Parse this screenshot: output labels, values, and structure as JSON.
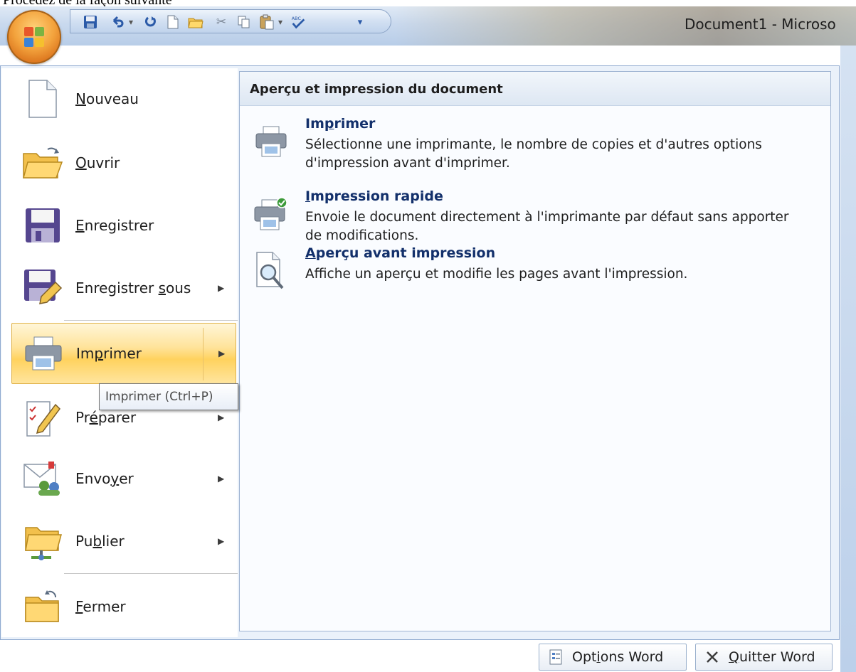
{
  "document_text": "Procédez de la façon suivante",
  "titlebar": {
    "title": "Document1 - Microso"
  },
  "quick_access": {
    "buttons": [
      {
        "name": "save-icon",
        "glyph": "💾"
      },
      {
        "name": "undo-icon",
        "glyph": "↶"
      },
      {
        "name": "undo-dropdown-icon",
        "glyph": "▾"
      },
      {
        "name": "redo-icon",
        "glyph": "↻"
      },
      {
        "name": "new-document-icon",
        "glyph": "🗋"
      },
      {
        "name": "open-folder-icon",
        "glyph": "🗁"
      },
      {
        "name": "cut-icon",
        "glyph": "✂"
      },
      {
        "name": "copy-icon",
        "glyph": "⎘"
      },
      {
        "name": "paste-icon",
        "glyph": "📋"
      },
      {
        "name": "paste-dropdown-icon",
        "glyph": "▾"
      },
      {
        "name": "spelling-icon",
        "glyph": "✓"
      },
      {
        "name": "customize-qat-icon",
        "glyph": "▾"
      }
    ]
  },
  "menu": {
    "items": [
      {
        "pre": "",
        "key": "N",
        "post": "ouveau",
        "submenu": false
      },
      {
        "pre": "",
        "key": "O",
        "post": "uvrir",
        "submenu": false
      },
      {
        "pre": "",
        "key": "E",
        "post": "nregistrer",
        "submenu": false
      },
      {
        "pre": "Enregistrer ",
        "key": "s",
        "post": "ous",
        "submenu": true
      },
      {
        "pre": "Im",
        "key": "p",
        "post": "rimer",
        "submenu": true,
        "selected": true
      },
      {
        "pre": "Pr",
        "key": "é",
        "post": "parer",
        "submenu": true
      },
      {
        "pre": "Envo",
        "key": "y",
        "post": "er",
        "submenu": true
      },
      {
        "pre": "Pu",
        "key": "b",
        "post": "lier",
        "submenu": true
      },
      {
        "pre": "",
        "key": "F",
        "post": "ermer",
        "submenu": false
      }
    ]
  },
  "tooltip": "Imprimer (Ctrl+P)",
  "right_panel": {
    "header": "Aperçu et impression du document",
    "items": [
      {
        "title_pre": "Im",
        "title_key": "p",
        "title_post": "rimer",
        "description": "Sélectionne une imprimante, le nombre de copies et d'autres options d'impression avant d'imprimer."
      },
      {
        "title_pre": "",
        "title_key": "I",
        "title_post": "mpression rapide",
        "description": "Envoie le document directement à l'imprimante par défaut sans apporter de modifications."
      },
      {
        "title_pre": "",
        "title_key": "A",
        "title_post": "perçu avant impression",
        "description": "Affiche un aperçu et modifie les pages avant l'impression."
      }
    ]
  },
  "bottom": {
    "options_pre": "Opt",
    "options_key": "i",
    "options_post": "ons Word",
    "quit_pre": "",
    "quit_key": "Q",
    "quit_post": "uitter Word"
  },
  "colors": {
    "selected_highlight": "#ffd25e",
    "panel_background": "#eaf1fa",
    "heading_text": "#13306b",
    "office_button": "#f3a33d"
  }
}
